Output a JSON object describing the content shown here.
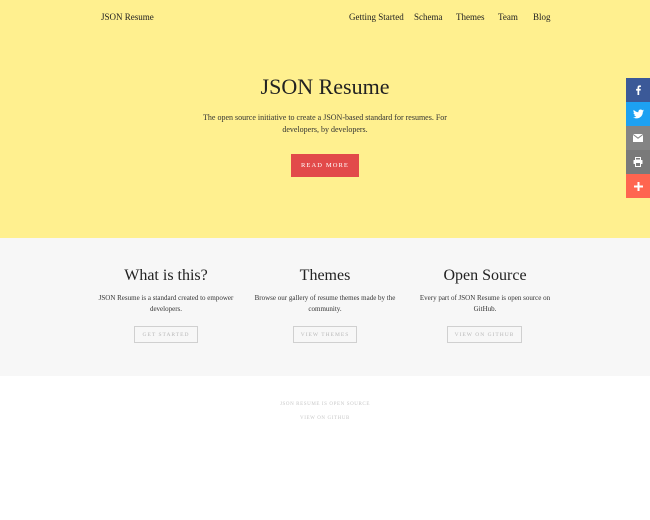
{
  "header": {
    "brand": "JSON Resume",
    "nav": [
      "Getting Started",
      "Schema",
      "Themes",
      "Team",
      "Blog"
    ]
  },
  "hero": {
    "title": "JSON Resume",
    "description": "The open source initiative to create a JSON-based standard for resumes. For developers, by developers.",
    "button": "READ MORE",
    "background": "#fff08f",
    "button_color": "#e24a4a"
  },
  "share": [
    {
      "icon": "facebook-icon",
      "color": "#3b5998"
    },
    {
      "icon": "twitter-icon",
      "color": "#1da1f2"
    },
    {
      "icon": "email-icon",
      "color": "#848484"
    },
    {
      "icon": "print-icon",
      "color": "#7a7a7a"
    },
    {
      "icon": "plus-icon",
      "color": "#ff6550"
    }
  ],
  "features": [
    {
      "title": "What is this?",
      "text": "JSON Resume is a standard created to empower developers.",
      "button": "GET STARTED"
    },
    {
      "title": "Themes",
      "text": "Browse our gallery of resume themes made by the community.",
      "button": "VIEW THEMES"
    },
    {
      "title": "Open Source",
      "text": "Every part of JSON Resume is open source on GitHub.",
      "button": "VIEW ON GITHUB"
    }
  ],
  "footer": {
    "line1": "JSON RESUME IS OPEN SOURCE",
    "line2": "VIEW ON GITHUB"
  }
}
